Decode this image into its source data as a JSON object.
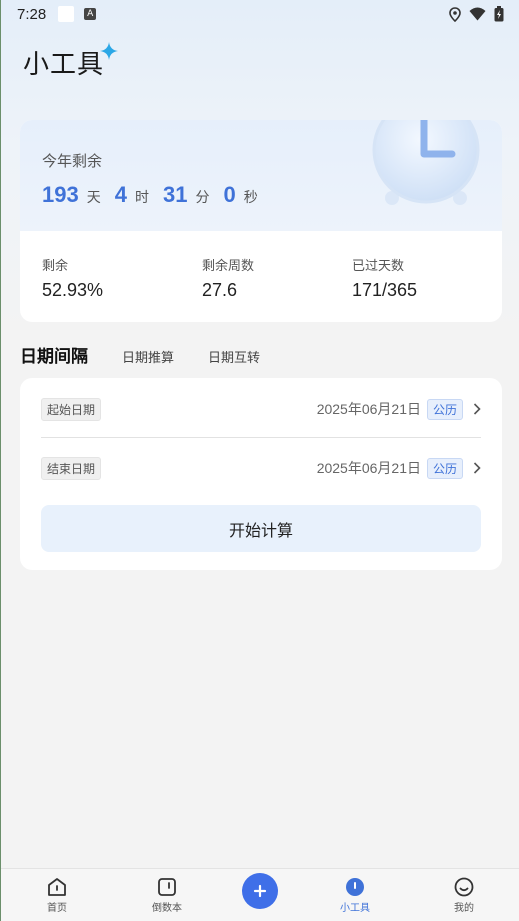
{
  "status_bar": {
    "time": "7:28",
    "notif_letter": "A"
  },
  "header": {
    "title": "小工具"
  },
  "year_card": {
    "label": "今年剩余",
    "countdown": [
      {
        "value": "193",
        "unit": "天"
      },
      {
        "value": "4",
        "unit": "时"
      },
      {
        "value": "31",
        "unit": "分"
      },
      {
        "value": "0",
        "unit": "秒"
      }
    ],
    "stats": [
      {
        "label": "剩余",
        "value": "52.93%"
      },
      {
        "label": "剩余周数",
        "value": "27.6"
      },
      {
        "label": "已过天数",
        "value": "171/365"
      }
    ]
  },
  "tabs": [
    {
      "label": "日期间隔",
      "active": true
    },
    {
      "label": "日期推算",
      "active": false
    },
    {
      "label": "日期互转",
      "active": false
    }
  ],
  "form": {
    "start": {
      "label": "起始日期",
      "date": "2025年06月21日",
      "calendar": "公历"
    },
    "end": {
      "label": "结束日期",
      "date": "2025年06月21日",
      "calendar": "公历"
    },
    "calc_button": "开始计算"
  },
  "bottom_nav": [
    {
      "label": "首页",
      "icon": "home-icon"
    },
    {
      "label": "倒数本",
      "icon": "countdown-book-icon"
    },
    {
      "label": "",
      "icon": "add-icon"
    },
    {
      "label": "小工具",
      "icon": "tools-icon",
      "active": true
    },
    {
      "label": "我的",
      "icon": "profile-icon"
    }
  ],
  "colors": {
    "accent": "#3f72d8",
    "fab": "#3f6fe8"
  }
}
